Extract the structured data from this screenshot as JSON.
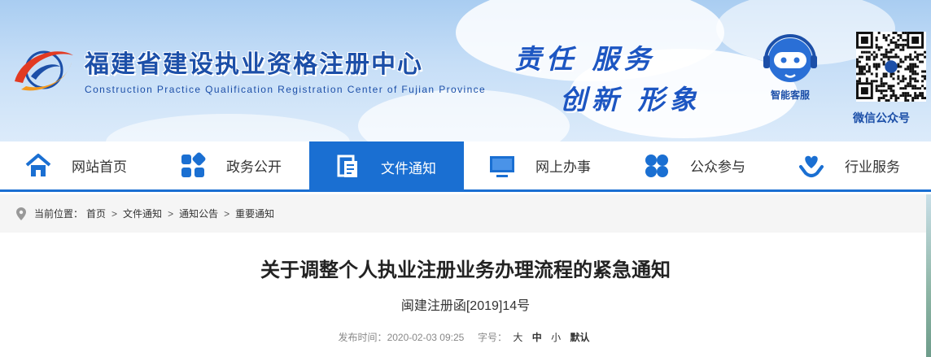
{
  "header": {
    "site_title": "福建省建设执业资格注册中心",
    "site_subtitle": "Construction Practice Qualification Registration Center of Fujian Province",
    "slogan_line1": "责任  服务",
    "slogan_line2": "创新  形象",
    "kefu_label": "智能客服",
    "qr_label": "微信公众号",
    "brand_color": "#1c4fa8"
  },
  "nav": {
    "active_color": "#1a6fd2",
    "items": [
      {
        "label": "网站首页",
        "icon": "home-icon"
      },
      {
        "label": "政务公开",
        "icon": "grid-icon"
      },
      {
        "label": "文件通知",
        "icon": "document-icon",
        "active": true
      },
      {
        "label": "网上办事",
        "icon": "monitor-icon"
      },
      {
        "label": "公众参与",
        "icon": "clover-icon"
      },
      {
        "label": "行业服务",
        "icon": "heart-hand-icon"
      }
    ]
  },
  "breadcrumb": {
    "prefix": "当前位置：",
    "items": [
      "首页",
      "文件通知",
      "通知公告",
      "重要通知"
    ],
    "separator": ">"
  },
  "article": {
    "title": "关于调整个人执业注册业务办理流程的紧急通知",
    "doc_number": "闽建注册函[2019]14号",
    "publish_label": "发布时间：",
    "publish_time": "2020-02-03 09:25",
    "font_size_label": "字号：",
    "font_sizes": [
      "大",
      "中",
      "小",
      "默认"
    ]
  }
}
